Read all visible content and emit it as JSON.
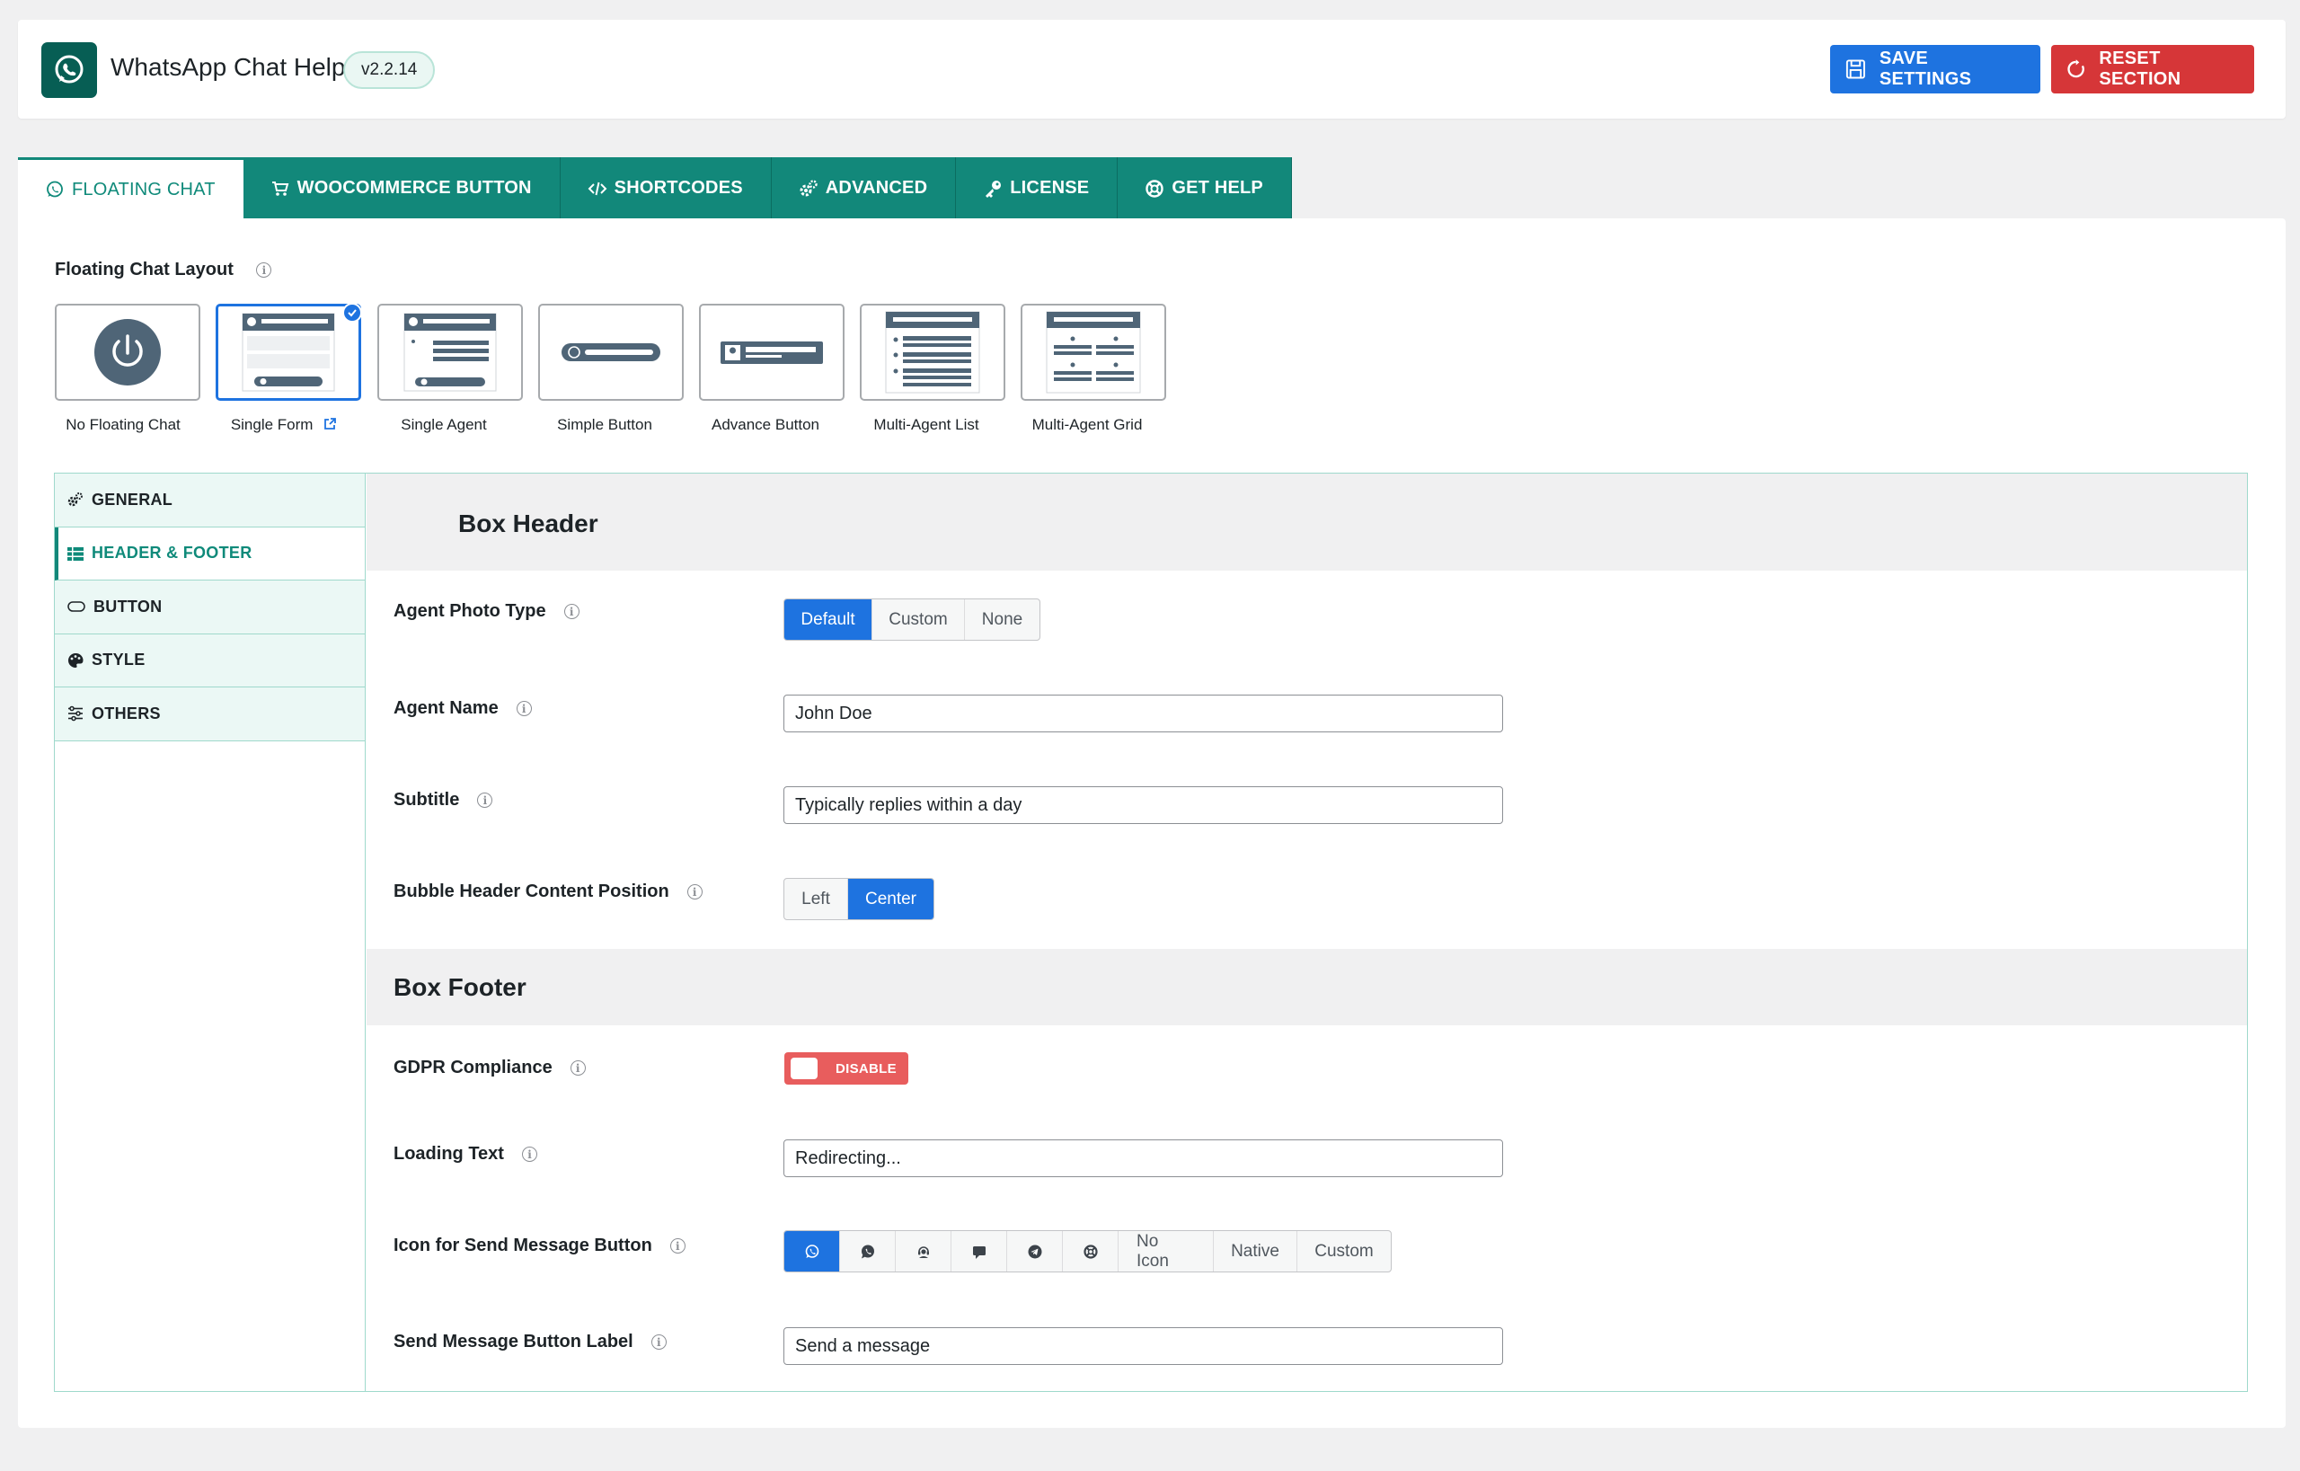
{
  "header": {
    "app_title": "WhatsApp Chat Help",
    "version": "v2.2.14",
    "save_label": "SAVE SETTINGS",
    "reset_label": "RESET SECTION",
    "colors": {
      "brand": "#075e54",
      "primary": "#1e73e0",
      "danger": "#d63638",
      "tab": "#12887a"
    }
  },
  "tabs": [
    {
      "label": "FLOATING CHAT",
      "icon": "whatsapp-icon",
      "active": true
    },
    {
      "label": "WOOCOMMERCE BUTTON",
      "icon": "cart-icon"
    },
    {
      "label": "SHORTCODES",
      "icon": "code-icon"
    },
    {
      "label": "ADVANCED",
      "icon": "gears-icon"
    },
    {
      "label": "LICENSE",
      "icon": "key-icon"
    },
    {
      "label": "GET HELP",
      "icon": "lifebuoy-icon"
    }
  ],
  "layout": {
    "label": "Floating Chat Layout",
    "options": [
      {
        "label": "No Floating Chat"
      },
      {
        "label": "Single Form",
        "selected": true
      },
      {
        "label": "Single Agent"
      },
      {
        "label": "Simple Button"
      },
      {
        "label": "Advance Button"
      },
      {
        "label": "Multi-Agent List"
      },
      {
        "label": "Multi-Agent Grid"
      }
    ]
  },
  "sidebar": {
    "items": [
      {
        "label": "GENERAL",
        "icon": "gears-icon"
      },
      {
        "label": "HEADER & FOOTER",
        "icon": "table-icon",
        "active": true
      },
      {
        "label": "BUTTON",
        "icon": "pill-icon"
      },
      {
        "label": "STYLE",
        "icon": "palette-icon"
      },
      {
        "label": "OTHERS",
        "icon": "sliders-icon"
      }
    ]
  },
  "box_header": {
    "title": "Box Header",
    "agent_photo_type": {
      "label": "Agent Photo Type",
      "options": [
        "Default",
        "Custom",
        "None"
      ],
      "selected": "Default"
    },
    "agent_name": {
      "label": "Agent Name",
      "value": "John Doe"
    },
    "subtitle": {
      "label": "Subtitle",
      "value": "Typically replies within a day"
    },
    "content_position": {
      "label": "Bubble Header Content Position",
      "options": [
        "Left",
        "Center"
      ],
      "selected": "Center"
    }
  },
  "box_footer": {
    "title": "Box Footer",
    "gdpr": {
      "label": "GDPR Compliance",
      "state": "DISABLE"
    },
    "loading_text": {
      "label": "Loading Text",
      "value": "Redirecting..."
    },
    "send_icon": {
      "label": "Icon for Send Message Button",
      "icon_options": [
        "whatsapp-icon",
        "whatsapp-solid-icon",
        "support-agent-icon",
        "comment-icon",
        "telegram-icon",
        "lifebuoy-icon"
      ],
      "text_options": [
        "No Icon",
        "Native",
        "Custom"
      ],
      "selected": "whatsapp-icon"
    },
    "send_label": {
      "label": "Send Message Button Label",
      "value": "Send a message"
    }
  }
}
